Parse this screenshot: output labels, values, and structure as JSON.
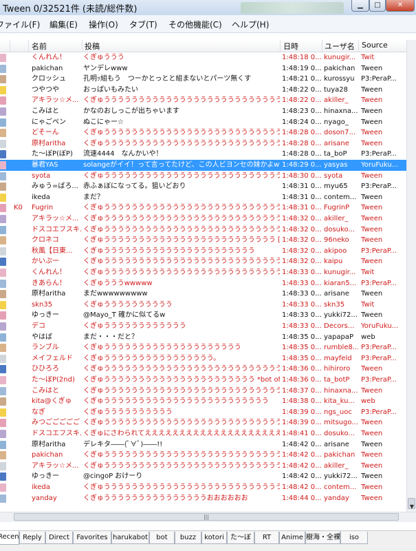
{
  "window": {
    "title": "Tween  0/32521件 (未読/総件数)"
  },
  "menu": [
    "ファイル(F)",
    "編集(E)",
    "操作(O)",
    "タブ(T)",
    "その他機能(C)",
    "ヘルプ(H)"
  ],
  "columns": {
    "name": "名前",
    "post": "投稿",
    "time": "日時",
    "user": "ユーザ名",
    "source": "Source"
  },
  "selected_row": 10,
  "rows": [
    {
      "name": "くんれん！",
      "post": "くぎゅううう",
      "time": "1:48:18 0...",
      "user": "kunugir...",
      "source": "Twit",
      "red": true,
      "mark": ""
    },
    {
      "name": "pakichan",
      "post": "ヤンデレwww",
      "time": "1:48:19 0...",
      "user": "pakichan",
      "source": "Tween",
      "red": false,
      "mark": ""
    },
    {
      "name": "クロッシュ",
      "post": "孔明ｯ組もう　つーかとっとと組まないとパーツ無くす",
      "time": "1:48:21 0...",
      "user": "kurossyu",
      "source": "P3:PeraP...",
      "red": false,
      "mark": ""
    },
    {
      "name": "つやつや",
      "post": "おっぱいもみたい",
      "time": "1:48:22 0...",
      "user": "tuya28",
      "source": "Tween",
      "red": false,
      "mark": ""
    },
    {
      "name": "アキラッ☆メ...",
      "post": "くぎゅうううううううううううううううううううううううううううううううう...",
      "time": "1:48:22 0...",
      "user": "akiller_",
      "source": "Tween",
      "red": true,
      "mark": ""
    },
    {
      "name": "こみはと",
      "post": "かなのおしっこが出ちゃいます",
      "time": "1:48:23 0...",
      "user": "hinaxna...",
      "source": "Tween",
      "red": false,
      "mark": ""
    },
    {
      "name": "にゃごペン",
      "post": "ぬこにゃー☆",
      "time": "1:48:24 0...",
      "user": "nyago_",
      "source": "Tween",
      "red": false,
      "mark": ""
    },
    {
      "name": "どそーん",
      "post": "くぎゅううううううううううううううううううううううううううううううう...",
      "time": "1:48:28 0...",
      "user": "doson7...",
      "source": "Tween",
      "red": true,
      "mark": ""
    },
    {
      "name": "原村aritha",
      "post": "くぎゅううううううううううううううううううううううううううううううう...",
      "time": "1:48:28 0...",
      "user": "arisane",
      "source": "Tween",
      "red": true,
      "mark": ""
    },
    {
      "name": "た〜ぼP(ぼP)",
      "post": "流速4444　なんかいや！",
      "time": "1:48:28 0...",
      "user": "ta_boP",
      "source": "P3:PeraP...",
      "red": false,
      "mark": ""
    },
    {
      "name": "暴君YAS",
      "post": "solangeがイイ！って言ってたけど、この人ビヨンセの妹かよwww...",
      "time": "1:48:29 0...",
      "user": "yasyas",
      "source": "YoruFuku...",
      "red": false,
      "mark": ""
    },
    {
      "name": "syota",
      "post": "くぎゅうううううううううううううううううううううううううううううううう...",
      "time": "1:48:30 0...",
      "user": "syota",
      "source": "Tween",
      "red": true,
      "mark": ""
    },
    {
      "name": "みゅう=ばろ...",
      "post": "赤ふぁぼになってる。狙いどおり",
      "time": "1:48:31 0...",
      "user": "myu65",
      "source": "P3:PeraP...",
      "red": false,
      "mark": ""
    },
    {
      "name": "ikeda",
      "post": "まだ？",
      "time": "1:48:31 0...",
      "user": "contem...",
      "source": "Tween",
      "red": false,
      "mark": ""
    },
    {
      "name": "Fugrin",
      "post": "くぎゅうううううううううううううううううううううううううう【アイコ...",
      "time": "1:48:31 0...",
      "user": "FugrinP",
      "source": "Tween",
      "red": true,
      "mark": "K0"
    },
    {
      "name": "アキラッ☆メ...",
      "post": "くぎゅうううううううううううううううううううううううううううううううう...",
      "time": "1:48:32 0...",
      "user": "akiller_",
      "source": "Tween",
      "red": true,
      "mark": ""
    },
    {
      "name": "ドスコエフスキ...",
      "post": "くぎゅうううううううううううううううううううううううううううううううう...",
      "time": "1:48:32 0...",
      "user": "dosuko...",
      "source": "Tween",
      "red": true,
      "mark": ""
    },
    {
      "name": "クロネコ",
      "post": "くぎゅううううううううううううううううううううううううう [Twn]",
      "time": "1:48:32 0...",
      "user": "96neko",
      "source": "Tween",
      "red": true,
      "mark": ""
    },
    {
      "name": "秋風【日東...",
      "post": "くぎゅうううううううううううううううううううううう",
      "time": "1:48:32 0...",
      "user": "akipoo",
      "source": "P3:PeraP...",
      "red": true,
      "mark": ""
    },
    {
      "name": "かいぷー",
      "post": "くぎゅうううううううううううううううううううううううううううううううう...",
      "time": "1:48:32 0...",
      "user": "kaipu",
      "source": "Tween",
      "red": true,
      "mark": ""
    },
    {
      "name": "くんれん！",
      "post": "くぎゅうううううううううううううううううううううううううううう",
      "time": "1:48:33 0...",
      "user": "kunugir...",
      "source": "Twit",
      "red": true,
      "mark": ""
    },
    {
      "name": "きあらん！",
      "post": "くぎゅうううwwwww",
      "time": "1:48:33 0...",
      "user": "kiaran5...",
      "source": "P3:PeraP...",
      "red": true,
      "mark": ""
    },
    {
      "name": "原村aritha",
      "post": "まだwwwwwwwww",
      "time": "1:48:33 0...",
      "user": "arisane",
      "source": "Tween",
      "red": false,
      "mark": ""
    },
    {
      "name": "skn35",
      "post": "くぎゅうううううううううう",
      "time": "1:48:33 0...",
      "user": "skn35",
      "source": "Twit",
      "red": true,
      "mark": ""
    },
    {
      "name": "ゆっきー",
      "post": "@Mayo_T 確かに似てるw",
      "time": "1:48:33 0...",
      "user": "yukki72...",
      "source": "Tween",
      "red": false,
      "mark": ""
    },
    {
      "name": "デコ",
      "post": "くぎゅうううううううううううう",
      "time": "1:48:33 0...",
      "user": "Decors...",
      "source": "YoruFuku...",
      "red": true,
      "mark": ""
    },
    {
      "name": "やはば",
      "post": "まだ・・・だと？",
      "time": "1:48:35 0...",
      "user": "yapapaP",
      "source": "web",
      "red": false,
      "mark": ""
    },
    {
      "name": "ランブル",
      "post": "くぎゅうううううううううううううううううううう",
      "time": "1:48:35 0...",
      "user": "rumble8...",
      "source": "P3:PeraP...",
      "red": true,
      "mark": ""
    },
    {
      "name": "メイフェルド",
      "post": "くぎゅうううううううううううううううう。",
      "time": "1:48:35 0...",
      "user": "mayfeld",
      "source": "P3:PeraP...",
      "red": true,
      "mark": ""
    },
    {
      "name": "ひひろろ",
      "post": "くぎゅうううううううううううううううううううううううううううううううう...",
      "time": "1:48:36 0...",
      "user": "hihiroro",
      "source": "Tween",
      "red": true,
      "mark": ""
    },
    {
      "name": "た〜ぼP(2nd)",
      "post": "くぎゅうううううううううううううううううううううう *bot of P3",
      "time": "1:48:36 0...",
      "user": "ta_botP",
      "source": "P3:PeraP...",
      "red": true,
      "mark": ""
    },
    {
      "name": "こみはと",
      "post": "くぎゅうううううううううううううううううううううううううううううう",
      "time": "1:48:37 0...",
      "user": "hinaxna...",
      "source": "Tween",
      "red": true,
      "mark": ""
    },
    {
      "name": "kita@くぎゅ",
      "post": "くぎゅうううううううううううううううううううううううう",
      "time": "1:48:38 0...",
      "user": "kita_ku...",
      "source": "web",
      "red": true,
      "mark": ""
    },
    {
      "name": "なぎ",
      "post": "くぎゅうううううううううう",
      "time": "1:48:39 0...",
      "user": "ngs_uoc",
      "source": "P3:PeraP...",
      "red": true,
      "mark": ""
    },
    {
      "name": "みつごごごごご",
      "post": "くぎゅうううううううううううううううううううううううううううう",
      "time": "1:48:39 0...",
      "user": "mitsugo...",
      "source": "Tween",
      "red": true,
      "mark": ""
    },
    {
      "name": "ドスコエフスキ...",
      "post": "くぎゅにさわられてえええええええええええええええええええええ...",
      "time": "1:48:41 0...",
      "user": "dosuko...",
      "source": "Tween",
      "red": true,
      "mark": ""
    },
    {
      "name": "原村aritha",
      "post": "デレキタ――(ﾟ∀ﾟ)――!!",
      "time": "1:48:42 0...",
      "user": "arisane",
      "source": "Tween",
      "red": false,
      "mark": ""
    },
    {
      "name": "pakichan",
      "post": "くぎゅううううううううううううううううううううううううううううううう...",
      "time": "1:48:42 0...",
      "user": "pakichan",
      "source": "Tween",
      "red": true,
      "mark": ""
    },
    {
      "name": "アキラッ☆メ...",
      "post": "くぎゅうううううううううううううううううううううううううううううう",
      "time": "1:48:42 0...",
      "user": "akiller_",
      "source": "Tween",
      "red": true,
      "mark": ""
    },
    {
      "name": "ゆっきー",
      "post": "@cingoP おけーり",
      "time": "1:48:42 0...",
      "user": "yukki72...",
      "source": "Tween",
      "red": false,
      "mark": ""
    },
    {
      "name": "ikeda",
      "post": "くぎゅうううううううううううううううううううううううううううううううう...",
      "time": "1:48:42 0...",
      "user": "contem...",
      "source": "Tween",
      "red": true,
      "mark": ""
    },
    {
      "name": "yanday",
      "post": "くぎゅうううううううううううううううおおおおおお",
      "time": "1:48:44 0...",
      "user": "yanday",
      "source": "Tween",
      "red": true,
      "mark": ""
    }
  ],
  "tabs": [
    "Recent",
    "Reply",
    "Direct",
    "Favorites",
    "harukabot",
    "bot",
    "buzz",
    "kotori",
    "た〜ぼ",
    "RT",
    "Anime",
    "樹海・全裸",
    "iso"
  ],
  "active_tab": 0,
  "colors": {
    "red_text": "#d01a1a",
    "normal_text": "#111111",
    "selection": "#3399ff"
  },
  "icons": [
    "window-minimize-icon",
    "window-maximize-icon",
    "window-close-icon",
    "scroll-down-icon",
    "scroll-grip-icon"
  ]
}
